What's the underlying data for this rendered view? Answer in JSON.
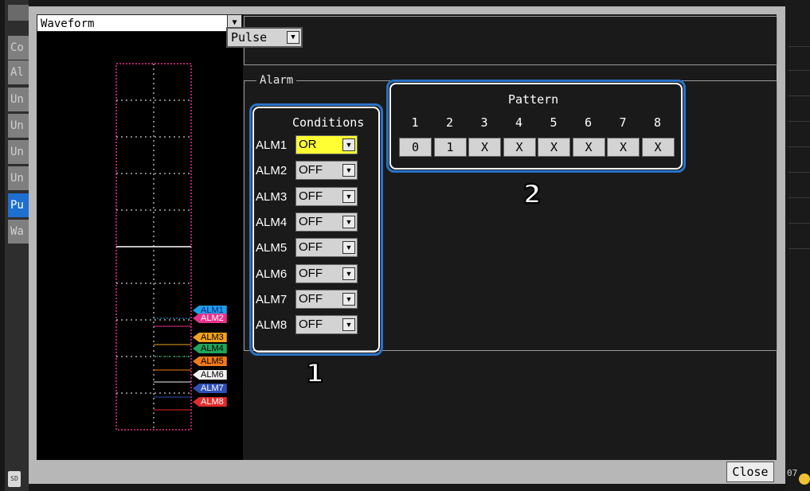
{
  "side_tabs": [
    "Co",
    "Al",
    "Un",
    "Un",
    "Un",
    "Un",
    "Pu",
    "Wa"
  ],
  "active_tab_index": 6,
  "waveform": {
    "selector_value": "Waveform",
    "alarm_tags": [
      {
        "label": "ALM1",
        "color": "#1ea0e6",
        "text_color": "#1a1a8a"
      },
      {
        "label": "ALM2",
        "color": "#e8318c",
        "text_color": "#ffffff"
      },
      {
        "label": "ALM3",
        "color": "#f2a21b",
        "text_color": "#000000"
      },
      {
        "label": "ALM4",
        "color": "#1fa55a",
        "text_color": "#000000"
      },
      {
        "label": "ALM5",
        "color": "#f07a1a",
        "text_color": "#000000"
      },
      {
        "label": "ALM6",
        "color": "#f0f0f0",
        "text_color": "#000000"
      },
      {
        "label": "ALM7",
        "color": "#2f4fb5",
        "text_color": "#ffffff"
      },
      {
        "label": "ALM8",
        "color": "#e02b2b",
        "text_color": "#ffffff"
      }
    ]
  },
  "pulse_selector": "Pulse",
  "alarm_group_label": "Alarm",
  "conditions": {
    "title": "Conditions",
    "rows": [
      {
        "label": "ALM1",
        "value": "OR",
        "highlighted": true
      },
      {
        "label": "ALM2",
        "value": "OFF",
        "highlighted": false
      },
      {
        "label": "ALM3",
        "value": "OFF",
        "highlighted": false
      },
      {
        "label": "ALM4",
        "value": "OFF",
        "highlighted": false
      },
      {
        "label": "ALM5",
        "value": "OFF",
        "highlighted": false
      },
      {
        "label": "ALM6",
        "value": "OFF",
        "highlighted": false
      },
      {
        "label": "ALM7",
        "value": "OFF",
        "highlighted": false
      },
      {
        "label": "ALM8",
        "value": "OFF",
        "highlighted": false
      }
    ]
  },
  "pattern": {
    "title": "Pattern",
    "numbers": [
      "1",
      "2",
      "3",
      "4",
      "5",
      "6",
      "7",
      "8"
    ],
    "values": [
      "0",
      "1",
      "X",
      "X",
      "X",
      "X",
      "X",
      "X"
    ]
  },
  "callouts": {
    "conditions_badge": "1",
    "pattern_badge": "2"
  },
  "close_label": "Close",
  "corner_text": "07",
  "sd_icon": "SD"
}
